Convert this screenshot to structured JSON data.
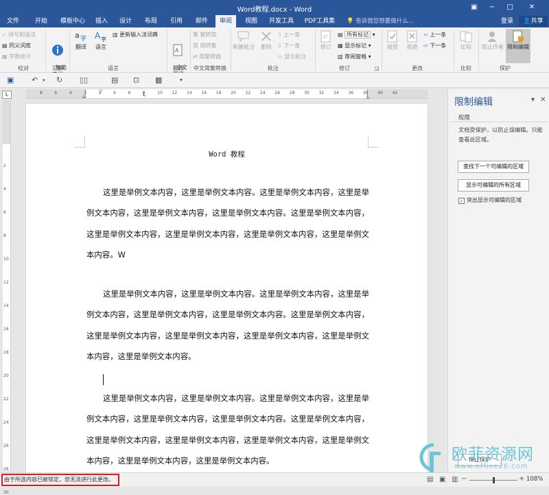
{
  "window": {
    "title": "Word教程.docx - Word",
    "restore_icon": "ribbon-display-icon",
    "min": "−",
    "max": "□",
    "close": "✕"
  },
  "menu": {
    "tabs": [
      "文件",
      "开始",
      "模板中心",
      "插入",
      "设计",
      "布局",
      "引用",
      "邮件",
      "审阅",
      "视图",
      "开发工具",
      "PDF工具集"
    ],
    "active": "审阅",
    "tell_me": "告诉我您想要做什么...",
    "login": "登录",
    "share": "共享"
  },
  "ribbon": {
    "proofing": {
      "spell": "拼写和语法",
      "thesaurus": "同义词库",
      "wordcount": "字数统计",
      "label": "校对"
    },
    "insights": {
      "smart": "智能\n查找",
      "label": "见解"
    },
    "language": {
      "translate": "翻译",
      "lang": "语言",
      "ime": "更新输入法词典",
      "label": "语言"
    },
    "fulltrans": {
      "btn": "全文\n翻译",
      "label": "翻译"
    },
    "chinese": {
      "t2s": "繁转简",
      "s2t": "简转繁",
      "conv": "简繁转换",
      "label": "中文简繁转换"
    },
    "comments": {
      "new": "新建批注",
      "delete": "删除",
      "prev": "上一条",
      "next": "下一条",
      "show": "显示批注",
      "label": "批注"
    },
    "tracking": {
      "track": "修订",
      "markup": "所有标记",
      "showmarkup": "显示标记",
      "pane": "审阅窗格",
      "label": "修订"
    },
    "changes": {
      "accept": "接受",
      "reject": "拒绝",
      "prev": "上一条",
      "next": "下一条",
      "label": "更改"
    },
    "compare": {
      "btn": "比较",
      "label": "比较"
    },
    "protect": {
      "block": "阻止作者",
      "restrict": "限制编辑",
      "label": "保护"
    }
  },
  "ruler": {
    "h_ticks": [
      "8",
      "6",
      "4",
      "2",
      "2",
      "4",
      "6",
      "8",
      "10",
      "12",
      "14",
      "16",
      "18",
      "20",
      "22",
      "24",
      "26",
      "28",
      "30",
      "32",
      "34",
      "36",
      "38",
      "40",
      "42"
    ],
    "v_ticks": [
      "2",
      "4",
      "6",
      "8",
      "10",
      "12",
      "14",
      "16",
      "18",
      "20",
      "22",
      "24",
      "26",
      "28",
      "30"
    ]
  },
  "document": {
    "title": "Word 教程",
    "paragraphs": [
      "这里是举例文本内容，这里是举例文本内容。这里是举例文本内容，这里是举例文本内容，这里是举例文本内容，这里是举例文本内容。这里是举例文本内容，这里是举例文本内容，这里是举例文本内容，这里是举例文本内容，这里是举例文本内容。W",
      "这里是举例文本内容，这里是举例文本内容。这里是举例文本内容，这里是举例文本内容，这里是举例文本内容，这里是举例文本内容。这里是举例文本内容，这里是举例文本内容，这里是举例文本内容，这里是举例文本内容，这里是举例文本内容，这里是举例文本内容。",
      "这里是举例文本内容，这里是举例文本内容。这里是举例文本内容，这里是举例文本内容，这里是举例文本内容，这里是举例文本内容。这里是举例文本内容，这里是举例文本内容，这里是举例文本内容，这里是举例文本内容，这里是举例文本内容，这里是举例文本内容，这里是举例文本内容。"
    ]
  },
  "pane": {
    "title": "限制编辑",
    "subtitle": "权限",
    "description": "文档受保护，以防止误编辑。只能查看此区域。",
    "find_next": "查找下一个可编辑的区域",
    "show_all": "显示可编辑的所有区域",
    "highlight": "突出显示可编辑的区域",
    "highlight_checked": true,
    "stop": "停止保护"
  },
  "status": {
    "message": "由于所选内容已被锁定，您无法进行此更改。",
    "zoom": "108%"
  },
  "watermark": {
    "text": "欧菲资源网",
    "url": "www.office26.com"
  }
}
